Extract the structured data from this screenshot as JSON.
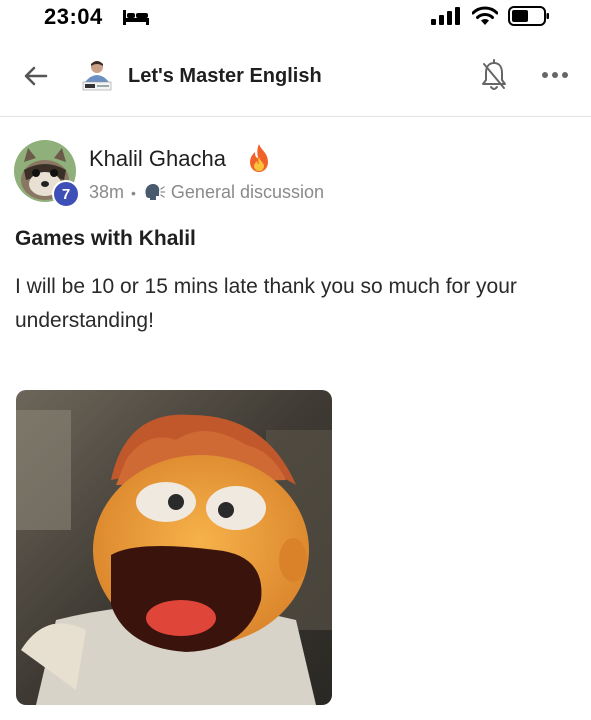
{
  "status_bar": {
    "time": "23:04",
    "icons": [
      "bed-icon",
      "signal-icon",
      "wifi-icon",
      "battery-icon"
    ]
  },
  "header": {
    "back_icon": "back-arrow-icon",
    "title": "Let's Master English",
    "bell_icon": "bell-off-icon",
    "more_icon": "more-icon"
  },
  "post": {
    "author_name": "Khalil Ghacha",
    "level": "7",
    "time_ago": "38m",
    "separator": "•",
    "category": "General discussion",
    "title": "Games with Khalil",
    "body": "I will be 10 or 15 mins late thank you so much for your understanding!"
  },
  "colors": {
    "badge": "#3f4fb8",
    "meta_text": "#8a8a8a",
    "divider": "#e3e3e3"
  }
}
